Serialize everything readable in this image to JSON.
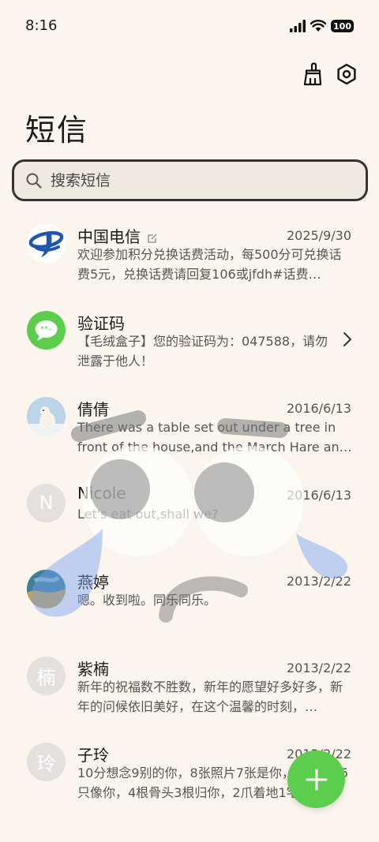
{
  "status": {
    "time": "8:16",
    "battery": "100"
  },
  "header": {
    "title": "短信"
  },
  "search": {
    "placeholder": "搜索短信"
  },
  "conversations": [
    {
      "name": "中国电信",
      "date": "2025/9/30",
      "preview": "欢迎参加积分兑换话费活动，每500分可兑换话费5元，兑换话费请回复106或jfdh#话费…"
    },
    {
      "name": "验证码",
      "date": "",
      "preview": "【毛绒盒子】您的验证码为：047588，请勿泄露于他人！"
    },
    {
      "name": "倩倩",
      "date": "2016/6/13",
      "preview": "There was a table set out under a tree in front of the house,and the March Hare an…"
    },
    {
      "name": "Nicole",
      "date": "2016/6/13",
      "preview": "Let's eat out,shall we?",
      "avatar_letter": "N"
    },
    {
      "name": "燕婷",
      "date": "2013/2/22",
      "preview": "嗯。收到啦。同乐同乐。"
    },
    {
      "name": "紫楠",
      "date": "2013/2/22",
      "preview": "新年的祝福数不胜数，新年的愿望好多好多，新年的问候依旧美好，在这个温馨的时刻，…",
      "avatar_letter": "楠"
    },
    {
      "name": "子玲",
      "date": "2013/2/22",
      "preview": "10分想念9别的你，8张照片7张是你，6只小狗5只像你，4根骨头3根归你，2爪着地1宅…",
      "avatar_letter": "玲"
    }
  ],
  "icons": {
    "clean": "broom-icon",
    "settings": "settings-icon",
    "new_message": "plus-icon"
  },
  "colors": {
    "background": "#fbf5ee",
    "fab": "#5ccd4d",
    "verification_avatar": "#5ccd4d",
    "telecom_blue": "#1e56b0"
  }
}
